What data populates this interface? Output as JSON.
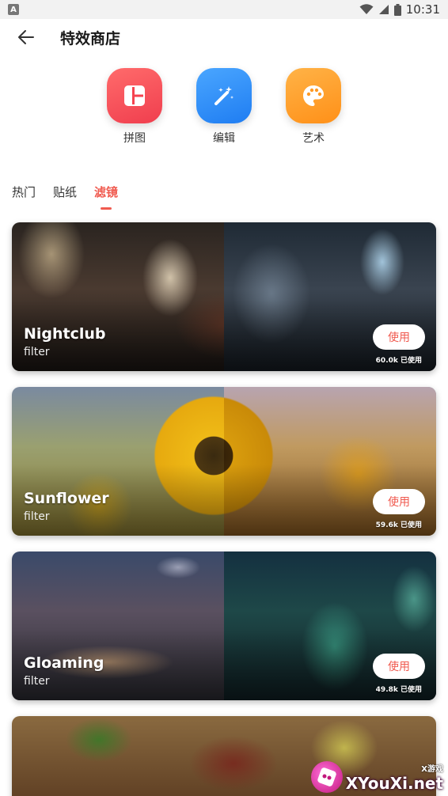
{
  "status_bar": {
    "sim_label": "A",
    "time": "10:31",
    "icons": [
      "wifi-icon",
      "signal-icon",
      "battery-icon"
    ]
  },
  "header": {
    "title": "特效商店",
    "back_icon": "arrow-left-icon"
  },
  "categories": [
    {
      "label": "拼图",
      "icon": "collage-icon",
      "color": "#f5434f"
    },
    {
      "label": "编辑",
      "icon": "magic-wand-icon",
      "color": "#2b86f5"
    },
    {
      "label": "艺术",
      "icon": "palette-icon",
      "color": "#ff9a25"
    }
  ],
  "tabs": [
    {
      "label": "热门",
      "active": false
    },
    {
      "label": "贴纸",
      "active": false
    },
    {
      "label": "滤镜",
      "active": true
    }
  ],
  "accent_color": "#f05a4f",
  "filters": [
    {
      "name": "Nightclub",
      "type": "filter",
      "button": "使用",
      "count": "60.0k 已使用"
    },
    {
      "name": "Sunflower",
      "type": "filter",
      "button": "使用",
      "count": "59.6k 已使用"
    },
    {
      "name": "Gloaming",
      "type": "filter",
      "button": "使用",
      "count": "49.8k 已使用"
    },
    {
      "name": "",
      "type": "",
      "button": "",
      "count": ""
    }
  ],
  "watermark": {
    "small": "X游戏",
    "big": "XYouXi.net"
  }
}
